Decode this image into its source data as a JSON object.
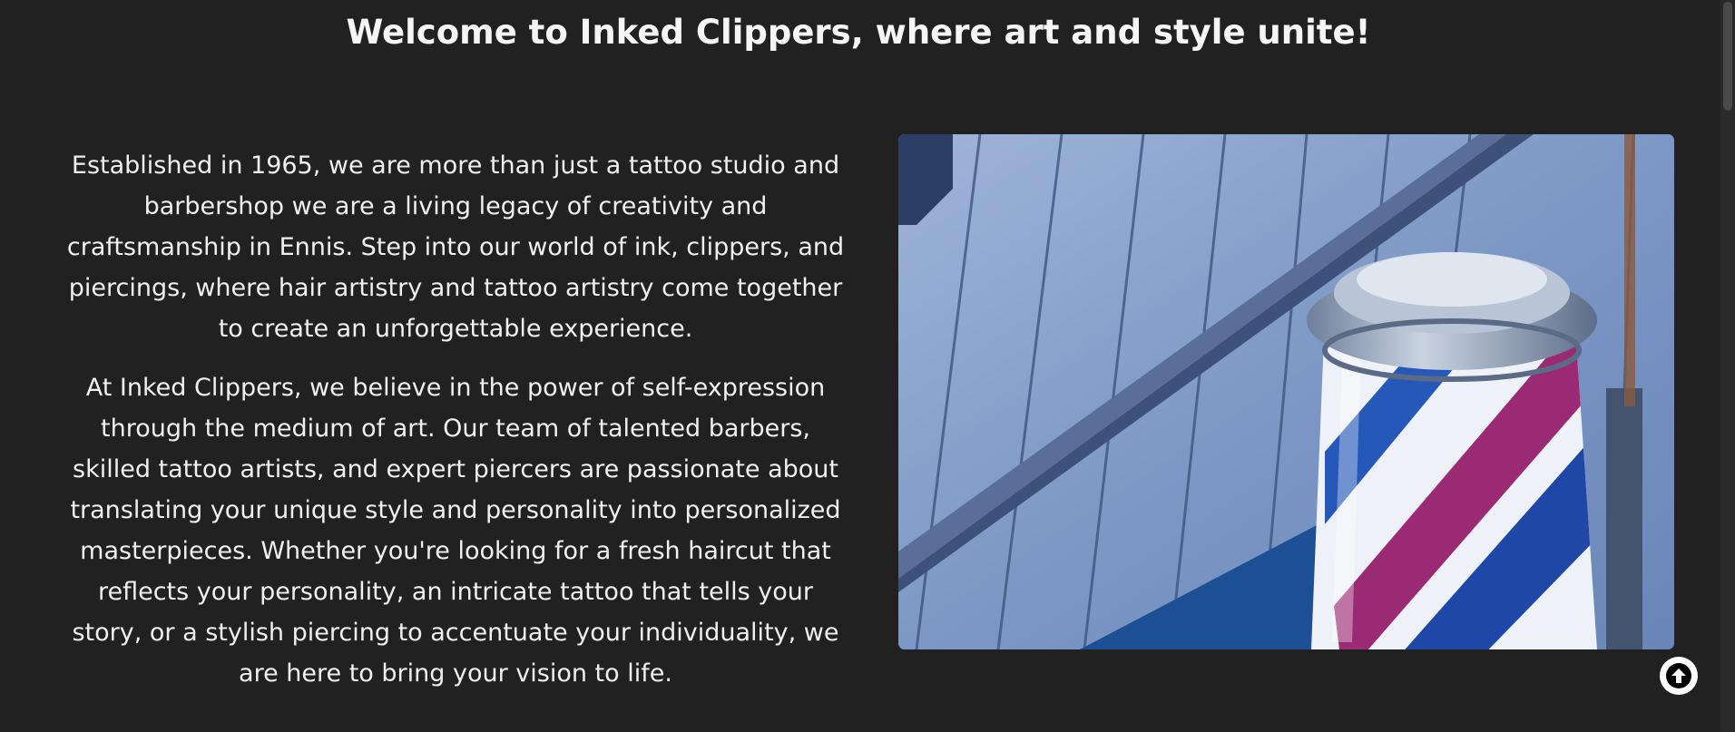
{
  "heading": "Welcome to Inked Clippers, where art and style unite!",
  "about": {
    "paragraphs": [
      "Established in 1965, we are more than just a tattoo studio and barbershop we are a living legacy of creativity and craftsmanship in Ennis. Step into our world of ink, clippers, and piercings, where hair artistry and tattoo artistry come together to create an unforgettable experience.",
      "At Inked Clippers, we believe in the power of self-expression through the medium of art. Our team of talented barbers, skilled tattoo artists, and expert piercers are passionate about translating your unique style and personality into personalized masterpieces. Whether you're looking for a fresh haircut that reflects your personality, an intricate tattoo that tells your story, or a stylish piercing to accentuate your individuality, we are here to bring your vision to life."
    ]
  },
  "image": {
    "subject": "barber-pole-photo"
  },
  "scroll_top": {
    "icon": "arrow-up-circle-icon"
  },
  "colors": {
    "background": "#212121",
    "text": "#f0f0f0",
    "pole_red": "#9b2a74",
    "pole_blue": "#1f47a8"
  }
}
